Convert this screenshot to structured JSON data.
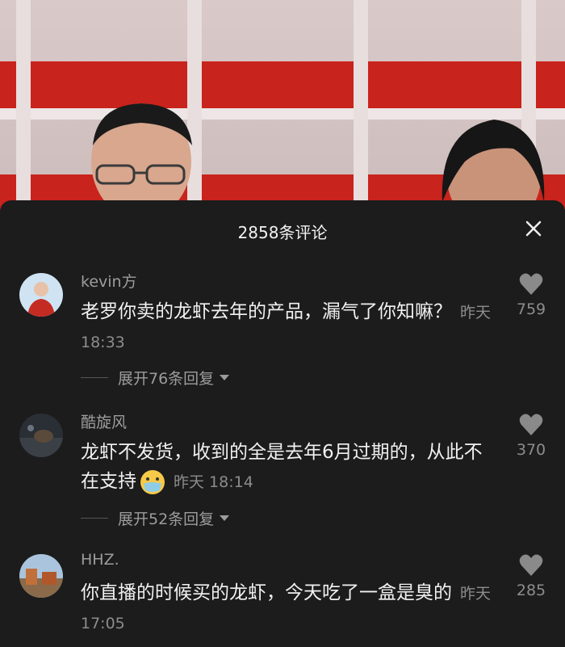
{
  "comments_panel": {
    "title": "2858条评论",
    "close_icon": "close-icon"
  },
  "comments": [
    {
      "username": "kevin方",
      "text": "老罗你卖的龙虾去年的产品，漏气了你知嘛？",
      "time": "昨天 18:33",
      "likes": "759",
      "replies": "展开76条回复"
    },
    {
      "username": "酷旋风",
      "text": "龙虾不发货，收到的全是去年6月过期的，从此不在支持",
      "emoji": "mask-face-emoji",
      "time": "昨天 18:14",
      "likes": "370",
      "replies": "展开52条回复"
    },
    {
      "username": "HHZ.",
      "text": "你直播的时候买的龙虾，今天吃了一盒是臭的",
      "time": "昨天 17:05",
      "likes": "285"
    }
  ],
  "colors": {
    "panel_bg": "#1c1c1c",
    "text_primary": "#f1f1f1",
    "text_secondary": "#9c9c9c",
    "video_red": "#c8231c"
  }
}
